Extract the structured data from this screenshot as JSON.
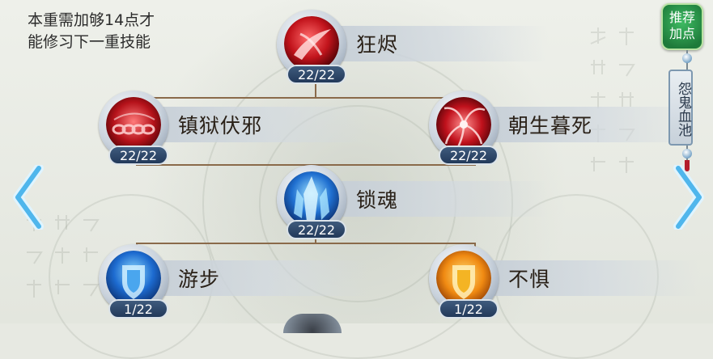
{
  "hint_lines": [
    "本重需加够14点才",
    "能修习下一重技能"
  ],
  "skills": [
    {
      "name": "狂烬",
      "level": "22/22",
      "art": "crimson-slash"
    },
    {
      "name": "镇狱伏邪",
      "level": "22/22",
      "art": "crimson-chains"
    },
    {
      "name": "朝生暮死",
      "level": "22/22",
      "art": "crimson-flower"
    },
    {
      "name": "锁魂",
      "level": "22/22",
      "art": "blue-crystal"
    },
    {
      "name": "游步",
      "level": "1/22",
      "art": "blue-shield"
    },
    {
      "name": "不惧",
      "level": "1/22",
      "art": "gold-shield"
    }
  ],
  "recommend_button": "推荐加点",
  "side_tab": "怨鬼血池",
  "colors": {
    "connector": "#8a6a4a",
    "level_badge": "#22395a",
    "recommend": "#1e7a3a",
    "arrow": "#4fb6ec"
  }
}
